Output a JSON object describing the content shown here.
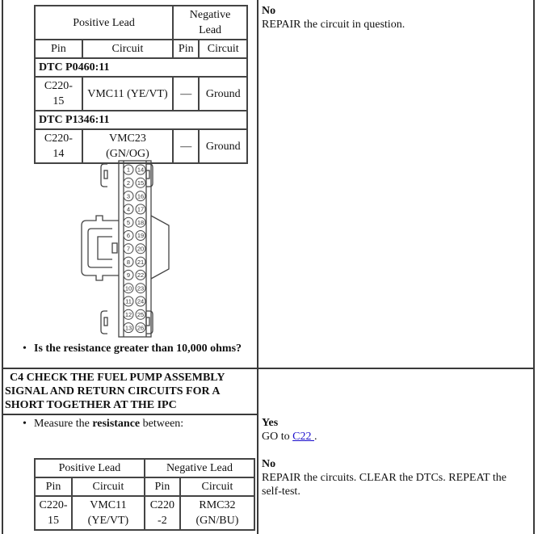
{
  "step_c3": {
    "table": {
      "header_groups": [
        "Positive Lead",
        "Negative Lead"
      ],
      "columns": [
        "Pin",
        "Circuit",
        "Pin",
        "Circuit"
      ],
      "sections": [
        {
          "dtc": "DTC P0460:11",
          "row": [
            "C220-15",
            "VMC11 (YE/VT)",
            "—",
            "Ground"
          ]
        },
        {
          "dtc": "DTC P1346:11",
          "row": [
            "C220-14",
            "VMC23 (GN/OG)",
            "—",
            "Ground"
          ]
        }
      ]
    },
    "connector": {
      "left_pins": [
        "1",
        "2",
        "3",
        "4",
        "5",
        "6",
        "7",
        "8",
        "9",
        "10",
        "11",
        "12",
        "13"
      ],
      "right_pins": [
        "14",
        "15",
        "16",
        "17",
        "18",
        "19",
        "20",
        "21",
        "22",
        "23",
        "24",
        "25",
        "26"
      ]
    },
    "question": "Is the resistance greater than 10,000 ohms?",
    "no_label": "No",
    "no_action": "REPAIR the circuit in question."
  },
  "step_c4": {
    "title": "C4 CHECK THE FUEL PUMP ASSEMBLY SIGNAL AND RETURN CIRCUITS FOR A SHORT TOGETHER AT THE IPC",
    "instruction_prefix": "Measure the ",
    "instruction_bold": "resistance",
    "instruction_suffix": " between:",
    "table": {
      "header_groups": [
        "Positive Lead",
        "Negative Lead"
      ],
      "columns": [
        "Pin",
        "Circuit",
        "Pin",
        "Circuit"
      ],
      "row": [
        "C220-15",
        "VMC11 (YE/VT)",
        "C220-2",
        "RMC32 (GN/BU)"
      ]
    },
    "yes_label": "Yes",
    "yes_action_prefix": "GO to ",
    "yes_link": "C22 ",
    "yes_action_suffix": ".",
    "no_label": "No",
    "no_action": "REPAIR the circuits. CLEAR the DTCs. REPEAT the self-test."
  }
}
